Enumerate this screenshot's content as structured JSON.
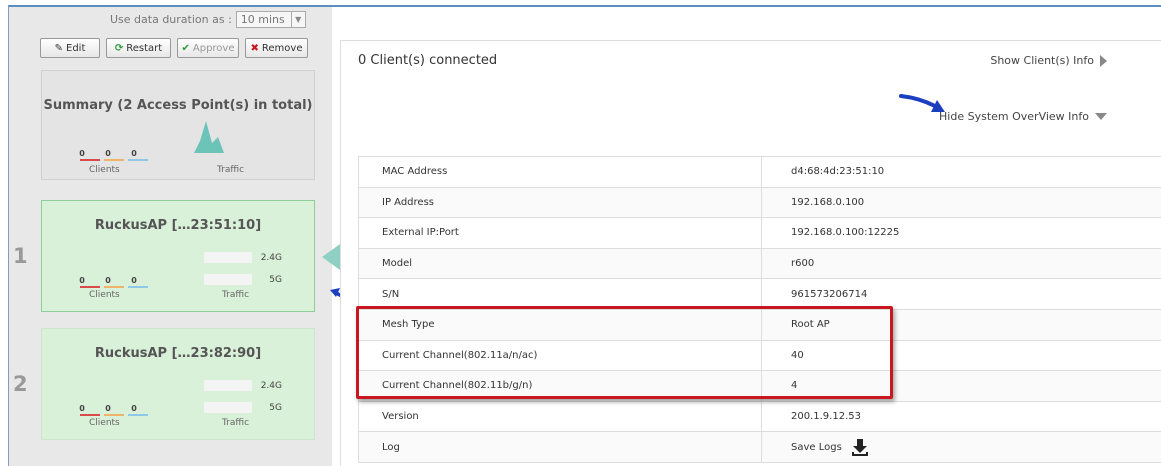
{
  "toolbar": {
    "duration_label": "Use data duration as :",
    "duration_value": "10 mins",
    "edit": "Edit",
    "restart": "Restart",
    "approve": "Approve",
    "remove": "Remove"
  },
  "summary": {
    "title": "Summary (2 Access Point(s) in total)",
    "stats": [
      "0",
      "0",
      "0"
    ],
    "clients_label": "Clients",
    "traffic_label": "Traffic"
  },
  "aps": [
    {
      "index": "1",
      "name": "RuckusAP […23:51:10]",
      "band1": "2.4G",
      "band2": "5G",
      "stats": [
        "0",
        "0",
        "0"
      ],
      "clients_label": "Clients",
      "traffic_label": "Traffic"
    },
    {
      "index": "2",
      "name": "RuckusAP […23:82:90]",
      "band1": "2.4G",
      "band2": "5G",
      "stats": [
        "0",
        "0",
        "0"
      ],
      "clients_label": "Clients",
      "traffic_label": "Traffic"
    }
  ],
  "detail": {
    "clients_connected": "0 Client(s) connected",
    "show_clients": "Show Client(s) Info",
    "hide_system": "Hide System OverView Info",
    "rows": [
      {
        "label": "MAC Address",
        "value": "d4:68:4d:23:51:10"
      },
      {
        "label": "IP Address",
        "value": "192.168.0.100"
      },
      {
        "label": "External IP:Port",
        "value": "192.168.0.100:12225"
      },
      {
        "label": "Model",
        "value": "r600"
      },
      {
        "label": "S/N",
        "value": "961573206714"
      },
      {
        "label": "Mesh Type",
        "value": "Root AP"
      },
      {
        "label": "Current Channel(802.11a/n/ac)",
        "value": "40"
      },
      {
        "label": "Current Channel(802.11b/g/n)",
        "value": "4"
      },
      {
        "label": "Version",
        "value": "200.1.9.12.53"
      },
      {
        "label": "Log",
        "value": "Save Logs"
      }
    ]
  },
  "colors": {
    "accent_blue": "#1b3fbf",
    "highlight_red": "#c8171e",
    "ap_green": "#d9f0d9",
    "teal_chart": "#6cc3b8"
  },
  "icons": {
    "edit": "pencil-icon",
    "restart": "refresh-icon",
    "approve": "check-icon",
    "remove": "x-icon",
    "save_logs": "download-icon"
  }
}
